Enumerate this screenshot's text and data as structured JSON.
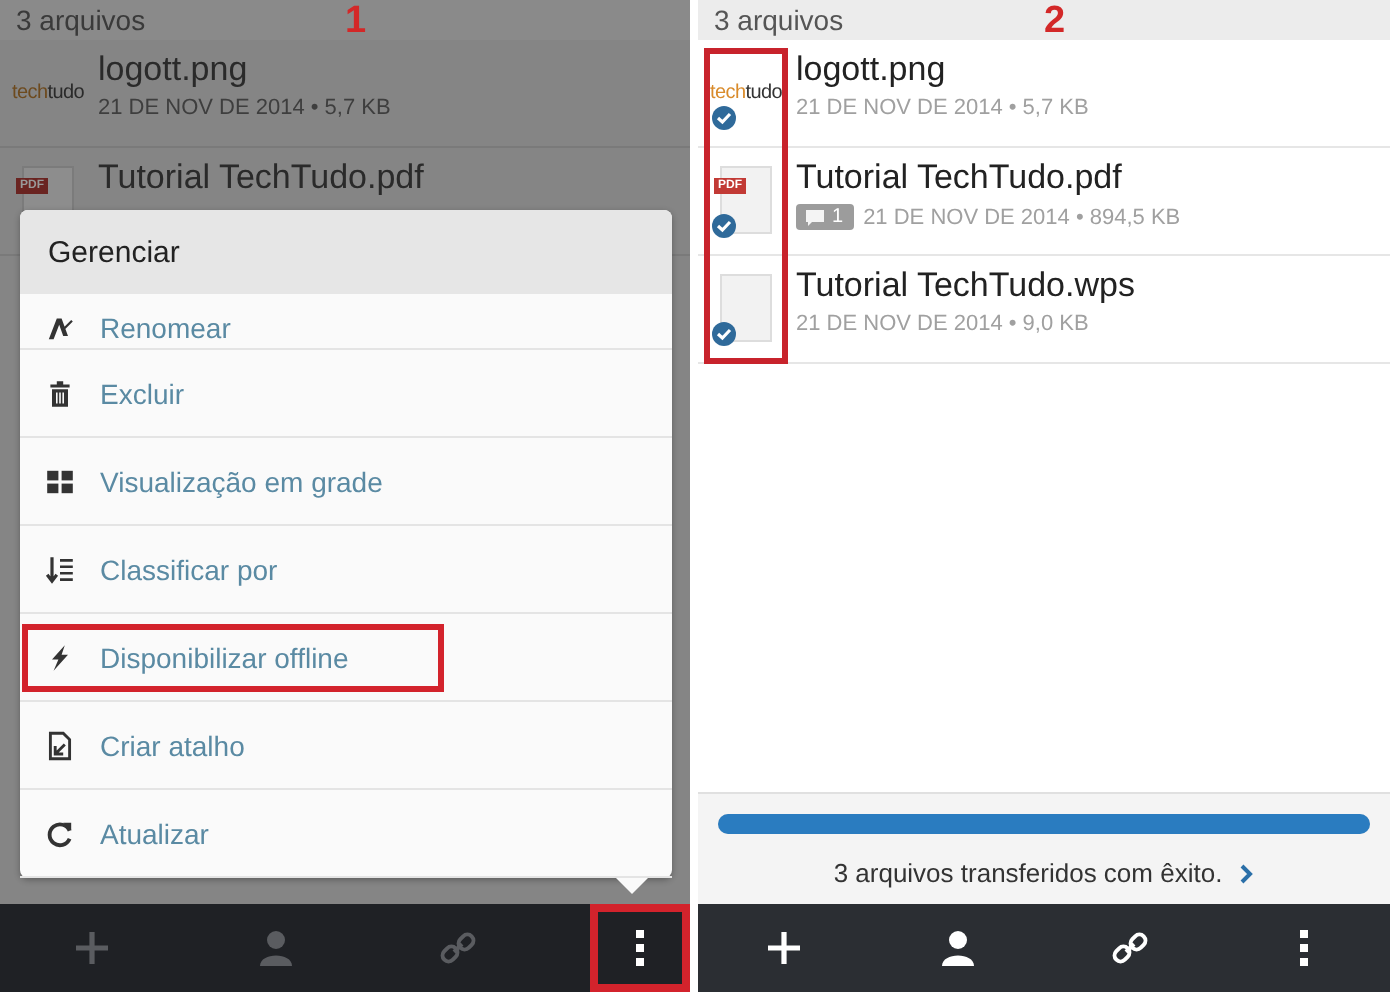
{
  "screens": [
    {
      "annotation": "1",
      "dimmed": true,
      "header": "3 arquivos",
      "files": [
        {
          "name": "logott.png",
          "meta": "21 DE NOV DE 2014 • 5,7 KB",
          "synced": false,
          "thumb": {
            "kind": "logo",
            "text_1": "tech",
            "text_2": "tudo"
          }
        },
        {
          "name": "Tutorial TechTudo.pdf",
          "synced": false,
          "thumb": {
            "kind": "pdf",
            "label": "PDF"
          }
        }
      ],
      "menu": {
        "title": "Gerenciar",
        "items": [
          {
            "label": "Renomear",
            "kind": "rename",
            "highlighted": false
          },
          {
            "label": "Excluir",
            "kind": "delete",
            "highlighted": false
          },
          {
            "label": "Visualização em grade",
            "kind": "grid",
            "highlighted": false
          },
          {
            "label": "Classificar por",
            "kind": "sort",
            "highlighted": false
          },
          {
            "label": "Disponibilizar offline",
            "kind": "offline",
            "highlighted": true
          },
          {
            "label": "Criar atalho",
            "kind": "shortcut",
            "highlighted": false
          },
          {
            "label": "Atualizar",
            "kind": "refresh",
            "highlighted": false
          }
        ]
      },
      "toolbar": [
        {
          "kind": "add",
          "highlighted": false
        },
        {
          "kind": "people",
          "highlighted": false
        },
        {
          "kind": "link",
          "highlighted": false
        },
        {
          "kind": "more",
          "highlighted": true
        }
      ]
    },
    {
      "annotation": "2",
      "dimmed": false,
      "header": "3 arquivos",
      "icons_highlighted": true,
      "files": [
        {
          "name": "logott.png",
          "meta": "21 DE NOV DE 2014 • 5,7 KB",
          "synced": true,
          "thumb": {
            "kind": "logo",
            "text_1": "tech",
            "text_2": "tudo"
          }
        },
        {
          "name": "Tutorial TechTudo.pdf",
          "comments": "1",
          "meta": "21 DE NOV DE 2014 • 894,5 KB",
          "synced": true,
          "thumb": {
            "kind": "pdf",
            "label": "PDF"
          }
        },
        {
          "name": "Tutorial TechTudo.wps",
          "meta": "21 DE NOV DE 2014 • 9,0 KB",
          "synced": true,
          "thumb": {
            "kind": "blank"
          }
        }
      ],
      "transfer": {
        "level": 1,
        "message": "3 arquivos transferidos com êxito."
      },
      "toolbar": [
        {
          "kind": "add",
          "highlighted": false
        },
        {
          "kind": "people",
          "highlighted": false
        },
        {
          "kind": "link",
          "highlighted": false
        },
        {
          "kind": "more",
          "highlighted": false
        }
      ]
    }
  ]
}
